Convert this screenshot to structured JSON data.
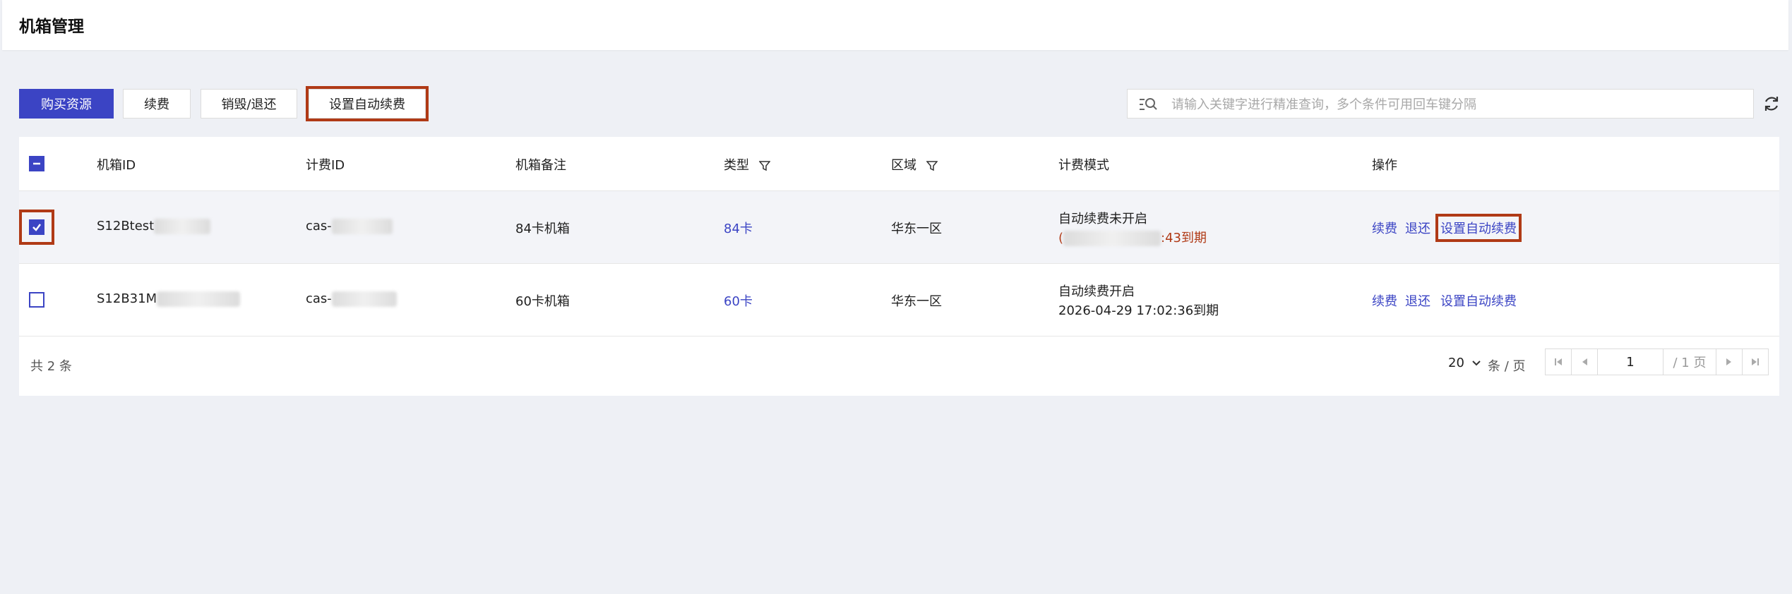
{
  "page": {
    "title": "机箱管理"
  },
  "toolbar": {
    "buy": "购买资源",
    "renew": "续费",
    "destroy": "销毁/退还",
    "auto_renew": "设置自动续费"
  },
  "search": {
    "placeholder": "请输入关键字进行精准查询，多个条件可用回车键分隔"
  },
  "table": {
    "columns": {
      "chassis_id": "机箱ID",
      "billing_id": "计费ID",
      "remark": "机箱备注",
      "type": "类型",
      "region": "区域",
      "billing_mode": "计费模式",
      "actions": "操作"
    },
    "rows": [
      {
        "selected": true,
        "chassis_id": "S12Btest",
        "billing_id": "cas-",
        "remark": "84卡机箱",
        "type": "84卡",
        "region": "华东一区",
        "mode_status": "自动续费未开启",
        "mode_expire_prefix": "(",
        "mode_expire": ":43到期",
        "actions": [
          "续费",
          "退还",
          "设置自动续费"
        ]
      },
      {
        "selected": false,
        "chassis_id": "S12B31M",
        "billing_id": "cas-",
        "remark": "60卡机箱",
        "type": "60卡",
        "region": "华东一区",
        "mode_status": "自动续费开启",
        "mode_expire": "2026-04-29 17:02:36到期",
        "actions": [
          "续费",
          "退还",
          "设置自动续费"
        ]
      }
    ]
  },
  "pagination": {
    "total": "共 2 条",
    "page_size": "20",
    "per_page_label": "条 / 页",
    "current": "1",
    "total_pages": "/ 1 页"
  },
  "colors": {
    "primary": "#3b44c4",
    "highlight": "#b03a16",
    "background": "#eef0f5"
  }
}
